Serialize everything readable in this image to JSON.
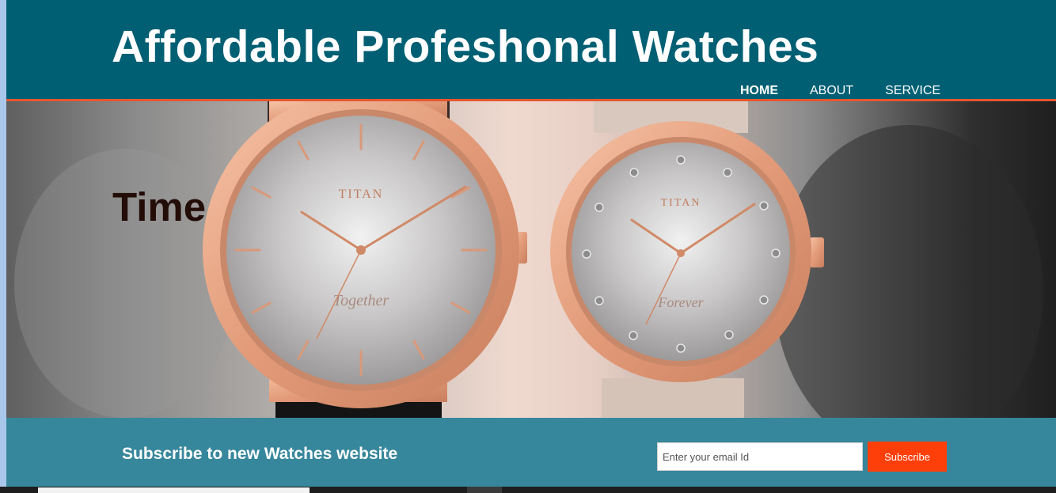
{
  "header": {
    "title": "Affordable Profeshonal Watches",
    "nav": [
      {
        "label": "HOME",
        "active": true
      },
      {
        "label": "ABOUT",
        "active": false
      },
      {
        "label": "SERVICE",
        "active": false
      }
    ]
  },
  "hero": {
    "headline": "Time",
    "left_watch": {
      "brand": "TITAN",
      "script": "Together"
    },
    "right_watch": {
      "brand": "TITAN",
      "script": "Forever"
    }
  },
  "subscribe": {
    "title": "Subscribe to new Watches website",
    "email_placeholder": "Enter your email Id",
    "button_label": "Subscribe"
  },
  "colors": {
    "header_bg": "#005f73",
    "accent_line": "#e4572e",
    "subscribe_bg": "#37879c",
    "button_bg": "#ff3f0a"
  }
}
